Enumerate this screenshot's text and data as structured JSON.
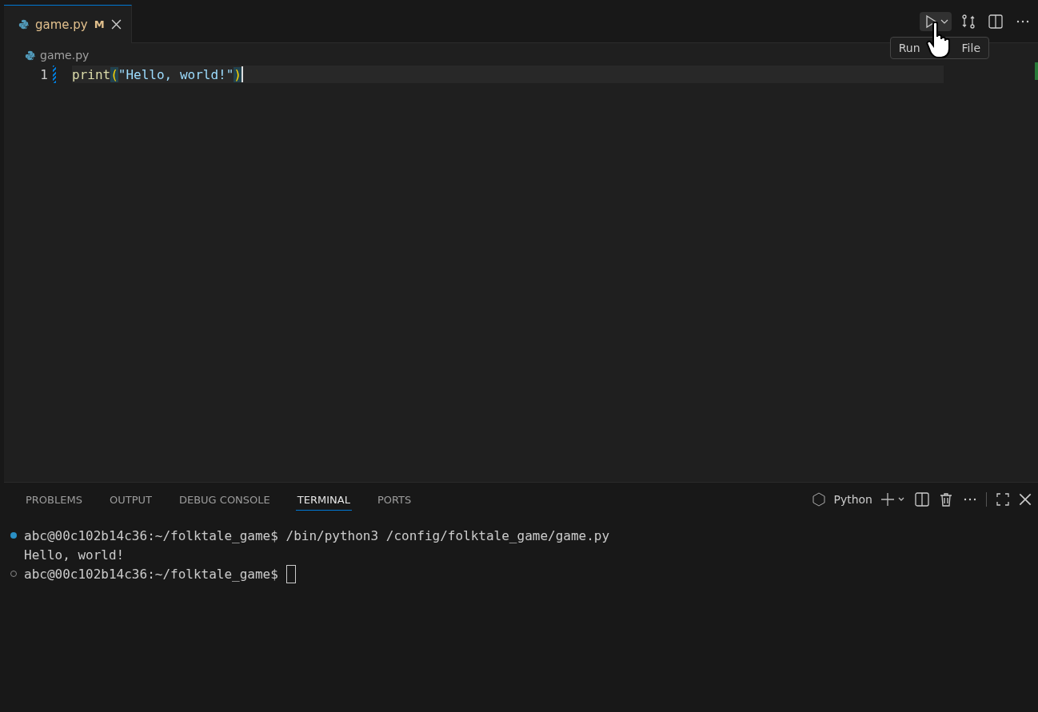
{
  "editor_tabs": [
    {
      "label": "game.py",
      "badge": "M",
      "selected": true
    }
  ],
  "breadcrumb": "game.py",
  "tooltip": {
    "before": "Run",
    "after": "File"
  },
  "code_lines": [
    {
      "number": "1",
      "tokens": [
        {
          "kind": "function",
          "text": "print"
        },
        {
          "kind": "bracket",
          "text": "("
        },
        {
          "kind": "string",
          "text": "\"Hello, world!\""
        },
        {
          "kind": "bracket",
          "text": ")"
        }
      ]
    }
  ],
  "panel_tabs": [
    {
      "label": "PROBLEMS",
      "selected": false
    },
    {
      "label": "OUTPUT",
      "selected": false
    },
    {
      "label": "DEBUG CONSOLE",
      "selected": false
    },
    {
      "label": "TERMINAL",
      "selected": true
    },
    {
      "label": "PORTS",
      "selected": false
    }
  ],
  "terminal_name": "Python",
  "terminal_lines": [
    {
      "kind": "command",
      "text": "abc@00c102b14c36:~/folktale_game$ /bin/python3 /config/folktale_game/game.py"
    },
    {
      "kind": "output",
      "text": "Hello, world!"
    },
    {
      "kind": "prompt",
      "text": "abc@00c102b14c36:~/folktale_game$ "
    }
  ]
}
